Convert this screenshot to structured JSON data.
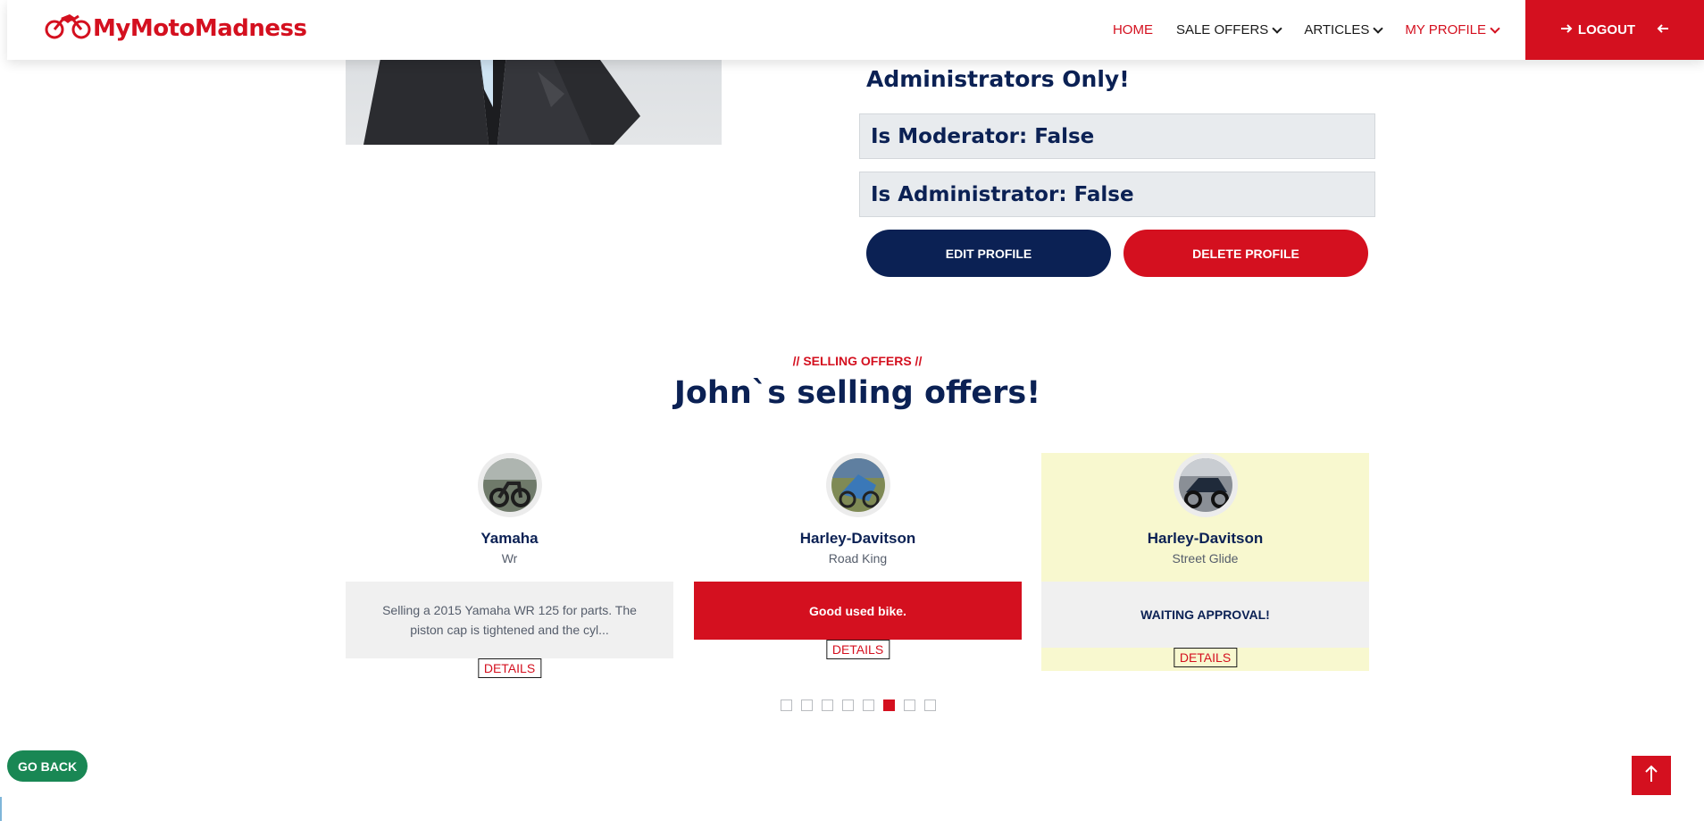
{
  "brand": {
    "name": "MyMotoMadness",
    "color": "#d4101f",
    "icon": "motorcycle-icon"
  },
  "nav": {
    "items": [
      {
        "label": "HOME",
        "active": true,
        "dropdown": false
      },
      {
        "label": "SALE OFFERS",
        "active": false,
        "dropdown": true
      },
      {
        "label": "ARTICLES",
        "active": false,
        "dropdown": true
      },
      {
        "label": "MY PROFILE",
        "active": true,
        "dropdown": true
      }
    ],
    "logout_label": "LOGOUT"
  },
  "profile": {
    "admin_heading": "Administrators Only!",
    "moderator_text": "Is Moderator: False",
    "administrator_text": "Is Administrator: False",
    "edit_label": "EDIT PROFILE",
    "delete_label": "DELETE PROFILE"
  },
  "offers_section": {
    "kicker": "// SELLING OFFERS //",
    "title": "John`s selling offers!",
    "cards": [
      {
        "make": "Yamaha",
        "model": "Wr",
        "description": "Selling a 2015 Yamaha WR 125 for parts. The piston cap is tightened and the cyl...",
        "details_label": "DETAILS"
      },
      {
        "make": "Harley-Davitson",
        "model": "Road King",
        "description": "Good used bike.",
        "details_label": "DETAILS"
      },
      {
        "make": "Harley-Davitson",
        "model": "Street Glide",
        "description": "WAITING APPROVAL!",
        "details_label": "DETAILS"
      }
    ],
    "pagination": {
      "count": 8,
      "active_index": 6
    }
  },
  "go_back_label": "GO BACK",
  "colors": {
    "navy": "#0b2154",
    "red": "#d4101f",
    "green": "#198754",
    "card_highlight": "#f8f8cf"
  }
}
